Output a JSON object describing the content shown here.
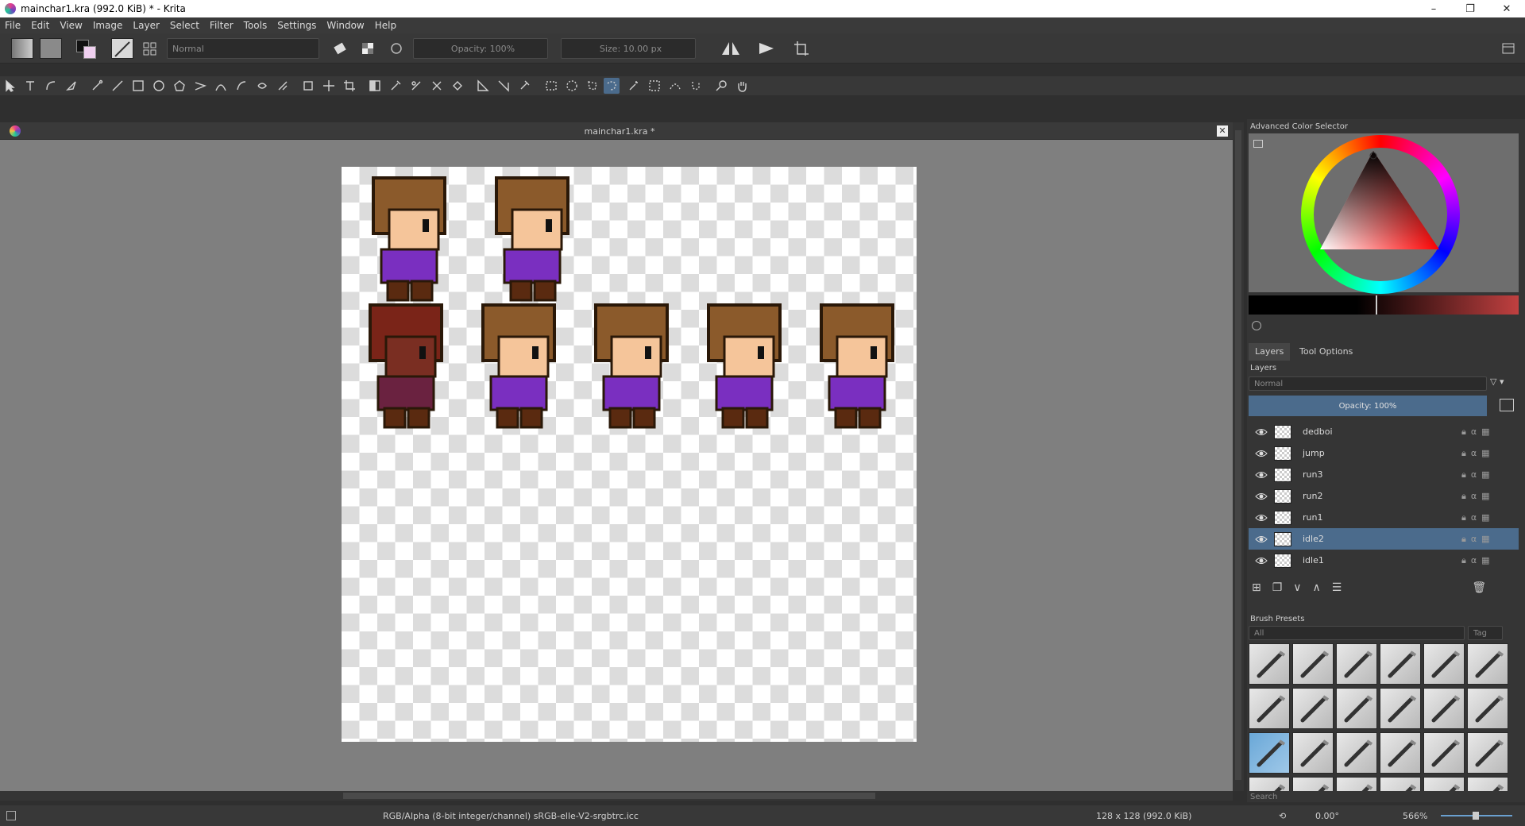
{
  "window": {
    "title": "mainchar1.kra (992.0 KiB)  * - Krita",
    "minimize": "–",
    "maximize": "❐",
    "close": "✕"
  },
  "menu": [
    "File",
    "Edit",
    "View",
    "Image",
    "Layer",
    "Select",
    "Filter",
    "Tools",
    "Settings",
    "Window",
    "Help"
  ],
  "toolbar": {
    "blend_mode": "Normal",
    "opacity": "Opacity: 100%",
    "size": "Size: 10.00 px"
  },
  "document": {
    "tab_title": "mainchar1.kra *",
    "sprites_top": [
      {
        "hair": "#8b5a2b",
        "skin": "#f5c59a",
        "shirt": "#7a2fc0"
      },
      {
        "hair": "#8b5a2b",
        "skin": "#f5c59a",
        "shirt": "#7a2fc0"
      }
    ],
    "sprites_bottom": [
      {
        "hair": "#7a2418",
        "skin": "#7a2e22",
        "shirt": "#6a2240"
      },
      {
        "hair": "#8b5a2b",
        "skin": "#f5c59a",
        "shirt": "#7a2fc0"
      },
      {
        "hair": "#8b5a2b",
        "skin": "#f5c59a",
        "shirt": "#7a2fc0"
      },
      {
        "hair": "#8b5a2b",
        "skin": "#f5c59a",
        "shirt": "#7a2fc0"
      },
      {
        "hair": "#8b5a2b",
        "skin": "#f5c59a",
        "shirt": "#7a2fc0"
      }
    ]
  },
  "color_selector": {
    "title": "Advanced Color Selector"
  },
  "layers_panel": {
    "tabs": [
      "Layers",
      "Tool Options"
    ],
    "title": "Layers",
    "blend_mode": "Normal",
    "opacity": "Opacity:  100%",
    "layers": [
      {
        "name": "dedboi",
        "selected": false
      },
      {
        "name": "jump",
        "selected": false
      },
      {
        "name": "run3",
        "selected": false
      },
      {
        "name": "run2",
        "selected": false
      },
      {
        "name": "run1",
        "selected": false
      },
      {
        "name": "idle2",
        "selected": true
      },
      {
        "name": "idle1",
        "selected": false
      }
    ]
  },
  "brush_presets": {
    "title": "Brush Presets",
    "filter": "All",
    "tag": "Tag",
    "search_placeholder": "Search"
  },
  "status": {
    "color_profile": "RGB/Alpha (8-bit integer/channel)  sRGB-elle-V2-srgbtrc.icc",
    "image_size": "128 x 128 (992.0 KiB)",
    "rotation": "0.00°",
    "zoom": "566%"
  }
}
